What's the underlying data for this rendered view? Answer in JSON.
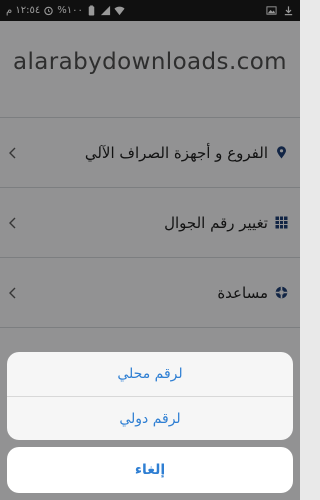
{
  "status_bar": {
    "time": "١٢:٥٤ م",
    "battery": "%١٠٠"
  },
  "watermark": "alarabydownloads.com",
  "menu": [
    {
      "label": "الفروع و أجهزة الصراف الآلي",
      "icon": "location-pin-icon"
    },
    {
      "label": "تغيير رقم الجوال",
      "icon": "grid-icon"
    },
    {
      "label": "مساعدة",
      "icon": "lifebuoy-icon"
    }
  ],
  "action_sheet": {
    "options": [
      "لرقم محلي",
      "لرقم دولي"
    ],
    "cancel": "إلغاء"
  },
  "colors": {
    "accent": "#2f7fd3",
    "icon": "#1e3e73"
  }
}
